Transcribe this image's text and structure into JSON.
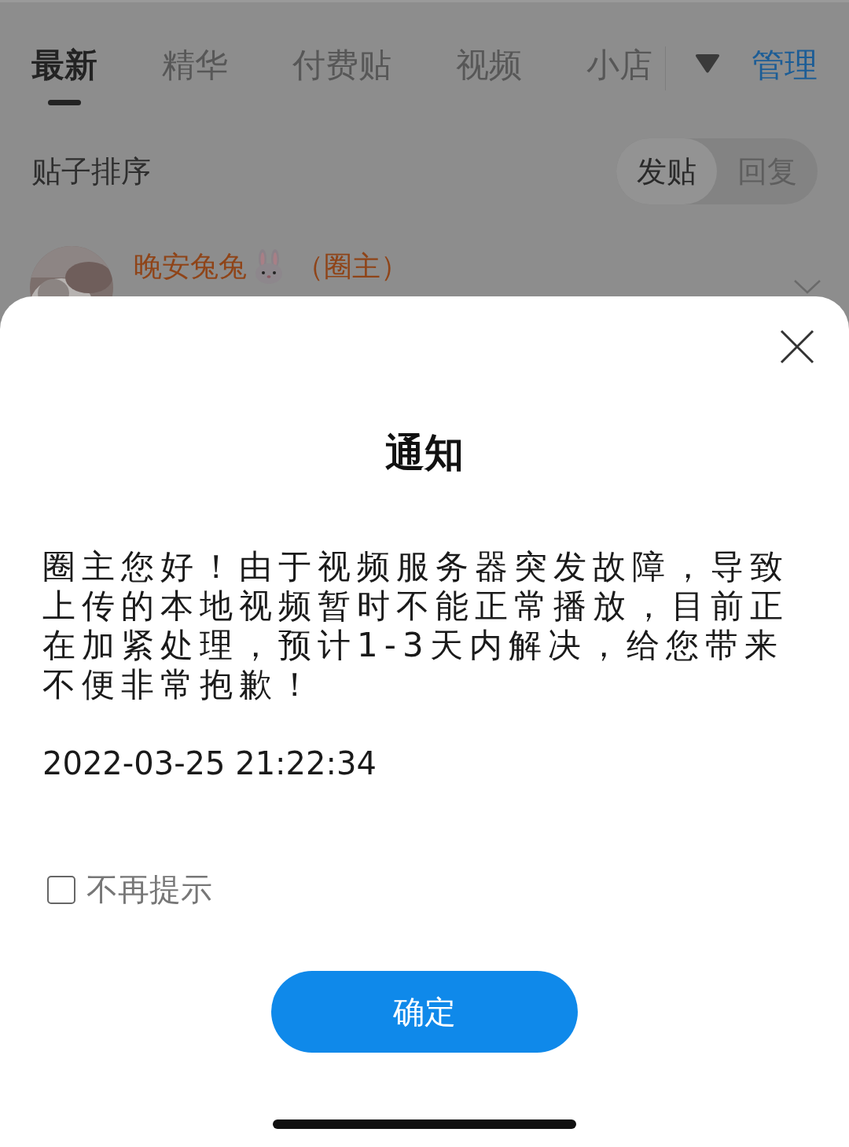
{
  "tabs": [
    {
      "label": "最新",
      "selected": true
    },
    {
      "label": "精华",
      "selected": false
    },
    {
      "label": "付费贴",
      "selected": false
    },
    {
      "label": "视频",
      "selected": false
    },
    {
      "label": "小店",
      "selected": false
    }
  ],
  "manage_link": "管理",
  "sort": {
    "label": "贴子排序",
    "options": [
      {
        "label": "发贴",
        "selected": true
      },
      {
        "label": "回复",
        "selected": false
      }
    ]
  },
  "post": {
    "author": "晚安兔兔",
    "role": "（圈主）"
  },
  "dialog": {
    "title": "通知",
    "message": "圈主您好！由于视频服务器突发故障，导致上传的本地视频暂时不能正常播放，目前正在加紧处理，预计1-3天内解决，给您带来不便非常抱歉！",
    "time": "2022-03-25 21:22:34",
    "checkbox": {
      "label": "不再提示",
      "checked": false
    },
    "button": "确定"
  }
}
